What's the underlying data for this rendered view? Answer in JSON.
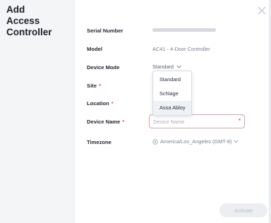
{
  "page": {
    "title": "Add\nAccess\nController"
  },
  "form": {
    "serial_label": "Serial Number",
    "model_label": "Model",
    "model_value": "AC41 - 4-Door Controller",
    "device_mode_label": "Device Mode",
    "device_mode_value": "Standard",
    "site_label": "Site",
    "location_label": "Location",
    "device_name_label": "Device Name",
    "device_name_placeholder": "Device Name",
    "device_name_value": "",
    "timezone_label": "Timezone",
    "timezone_value": "America/Los_Angeles (GMT-8)",
    "required_mark": "*"
  },
  "device_mode_options": [
    "Standard",
    "Schlage",
    "Assa Abloy"
  ],
  "hovered_option": "Assa Abloy",
  "actions": {
    "activate_label": "Activate",
    "activate_enabled": false
  },
  "icons": {
    "close": "close-icon",
    "mode_chevron": "chevron-down-icon",
    "timezone": "globe-icon",
    "timezone_chevron": "chevron-down-icon"
  },
  "colors": {
    "required": "#e0475b",
    "input_border": "#d3a3ad",
    "dropdown_hover": "#eef1f5",
    "button_disabled_bg": "#eceef1"
  }
}
